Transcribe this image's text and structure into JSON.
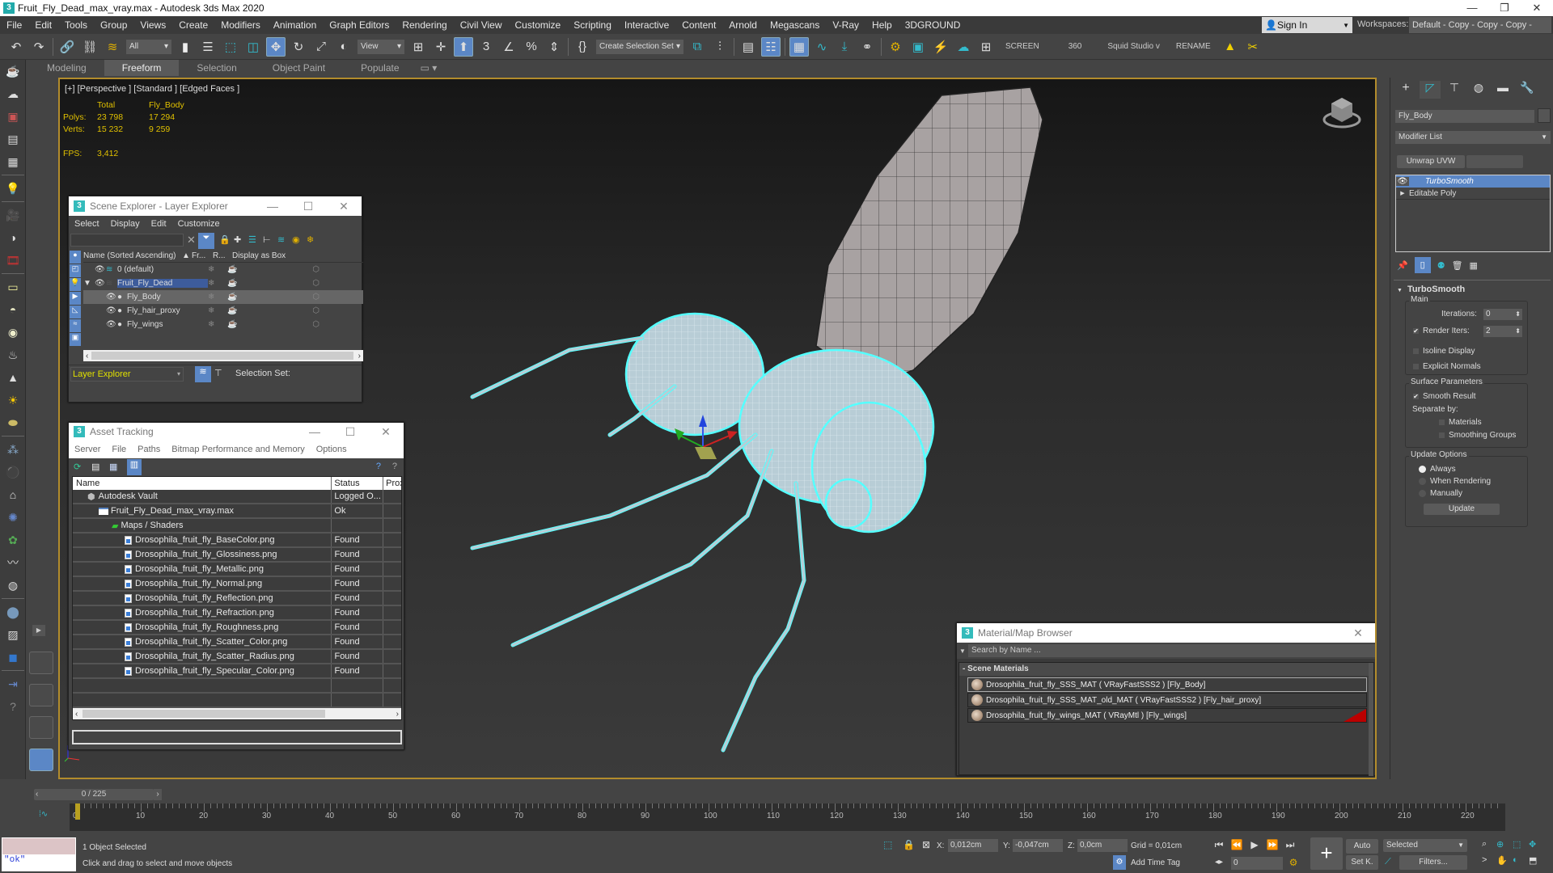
{
  "window": {
    "title": "Fruit_Fly_Dead_max_vray.max - Autodesk 3ds Max 2020",
    "controls": [
      "—",
      "❐",
      "✕"
    ]
  },
  "menubar": {
    "items": [
      "File",
      "Edit",
      "Tools",
      "Group",
      "Views",
      "Create",
      "Modifiers",
      "Animation",
      "Graph Editors",
      "Rendering",
      "Civil View",
      "Customize",
      "Scripting",
      "Interactive",
      "Content",
      "Arnold",
      "Megascans",
      "V-Ray",
      "Help",
      "3DGROUND"
    ],
    "sign_in": "Sign In",
    "workspaces_label": "Workspaces:",
    "workspace_value": "Default - Copy - Copy - Copy - Copy"
  },
  "toolbar": {
    "selection_filter": "All",
    "reference_coord": "View",
    "named_selection": "Create Selection Set",
    "text_buttons": [
      "SCREEN",
      "360",
      "Squid Studio v",
      "RENAME"
    ]
  },
  "ribbon": {
    "tabs": [
      "Modeling",
      "Freeform",
      "Selection",
      "Object Paint",
      "Populate"
    ],
    "active": "Freeform"
  },
  "viewport": {
    "label": "[+] [Perspective ] [Standard ] [Edged Faces ]",
    "stats": {
      "col_total": "Total",
      "col_object": "Fly_Body",
      "polys_label": "Polys:",
      "polys_total": "23 798",
      "polys_object": "17 294",
      "verts_label": "Verts:",
      "verts_total": "15 232",
      "verts_object": "9 259",
      "fps_label": "FPS:",
      "fps_value": "3,412"
    }
  },
  "scene_explorer": {
    "title": "Scene Explorer - Layer Explorer",
    "menu": [
      "Select",
      "Display",
      "Edit",
      "Customize"
    ],
    "columns": [
      "Name (Sorted Ascending)",
      "Fr...",
      "R...",
      "Display as Box"
    ],
    "rows": [
      {
        "name": "0 (default)",
        "indent": 0,
        "type": "layer"
      },
      {
        "name": "Fruit_Fly_Dead",
        "indent": 0,
        "type": "layer-active"
      },
      {
        "name": "Fly_Body",
        "indent": 1,
        "type": "object",
        "selected": true
      },
      {
        "name": "Fly_hair_proxy",
        "indent": 1,
        "type": "object"
      },
      {
        "name": "Fly_wings",
        "indent": 1,
        "type": "object"
      }
    ],
    "explorer_type": "Layer Explorer",
    "selection_set_label": "Selection Set:"
  },
  "asset_tracking": {
    "title": "Asset Tracking",
    "menu": [
      "Server",
      "File",
      "Paths",
      "Bitmap Performance and Memory",
      "Options"
    ],
    "columns": [
      "Name",
      "Status",
      "Prox"
    ],
    "rows": [
      {
        "name": "Autodesk Vault",
        "status": "Logged O...",
        "level": 0
      },
      {
        "name": "Fruit_Fly_Dead_max_vray.max",
        "status": "Ok",
        "level": 1
      },
      {
        "name": "Maps / Shaders",
        "status": "",
        "level": 2
      },
      {
        "name": "Drosophila_fruit_fly_BaseColor.png",
        "status": "Found",
        "level": 3
      },
      {
        "name": "Drosophila_fruit_fly_Glossiness.png",
        "status": "Found",
        "level": 3
      },
      {
        "name": "Drosophila_fruit_fly_Metallic.png",
        "status": "Found",
        "level": 3
      },
      {
        "name": "Drosophila_fruit_fly_Normal.png",
        "status": "Found",
        "level": 3
      },
      {
        "name": "Drosophila_fruit_fly_Reflection.png",
        "status": "Found",
        "level": 3
      },
      {
        "name": "Drosophila_fruit_fly_Refraction.png",
        "status": "Found",
        "level": 3
      },
      {
        "name": "Drosophila_fruit_fly_Roughness.png",
        "status": "Found",
        "level": 3
      },
      {
        "name": "Drosophila_fruit_fly_Scatter_Color.png",
        "status": "Found",
        "level": 3
      },
      {
        "name": "Drosophila_fruit_fly_Scatter_Radius.png",
        "status": "Found",
        "level": 3
      },
      {
        "name": "Drosophila_fruit_fly_Specular_Color.png",
        "status": "Found",
        "level": 3
      }
    ]
  },
  "material_browser": {
    "title": "Material/Map Browser",
    "search_placeholder": "Search by Name ...",
    "section": "- Scene Materials",
    "materials": [
      "Drosophila_fruit_fly_SSS_MAT  ( VRayFastSSS2 )  [Fly_Body]",
      "Drosophila_fruit_fly_SSS_MAT_old_MAT  ( VRayFastSSS2 )  [Fly_hair_proxy]",
      "Drosophila_fruit_fly_wings_MAT  ( VRayMtl )  [Fly_wings]"
    ]
  },
  "command_panel": {
    "object_name": "Fly_Body",
    "modifier_list": "Modifier List",
    "quick_button": "Unwrap UVW",
    "stack": [
      "TurboSmooth",
      "Editable Poly"
    ],
    "rollout_title": "TurboSmooth",
    "main_group": "Main",
    "iterations_label": "Iterations:",
    "iterations_value": "0",
    "render_iters_label": "Render Iters:",
    "render_iters_value": "2",
    "render_iters_checked": true,
    "isoline_label": "Isoline Display",
    "isoline_checked": false,
    "explicit_normals_label": "Explicit Normals",
    "explicit_normals_checked": false,
    "surface_group": "Surface Parameters",
    "smooth_result_label": "Smooth Result",
    "smooth_result_checked": true,
    "separate_by_label": "Separate by:",
    "materials_label": "Materials",
    "smoothing_groups_label": "Smoothing Groups",
    "update_group": "Update Options",
    "update_options": [
      "Always",
      "When Rendering",
      "Manually"
    ],
    "update_selected": "Always",
    "update_button": "Update"
  },
  "timeline": {
    "frame_display": "0 / 225",
    "current_frame": 0,
    "total_frames": 225,
    "ticks": [
      0,
      10,
      20,
      30,
      40,
      50,
      60,
      70,
      80,
      90,
      100,
      110,
      120,
      130,
      140,
      150,
      160,
      170,
      180,
      190,
      200,
      210,
      220
    ]
  },
  "status": {
    "maxscript_output": "\"ok\"",
    "selection_info": "1 Object Selected",
    "prompt": "Click and drag to select and move objects",
    "x_label": "X:",
    "x_value": "0,012cm",
    "y_label": "Y:",
    "y_value": "-0,047cm",
    "z_label": "Z:",
    "z_value": "0,0cm",
    "grid": "Grid = 0,01cm",
    "add_time_tag": "Add Time Tag",
    "auto_key": "Auto",
    "set_key": "Set K.",
    "key_filter_select": "Selected",
    "filters": "Filters...",
    "frame_field": "0"
  }
}
